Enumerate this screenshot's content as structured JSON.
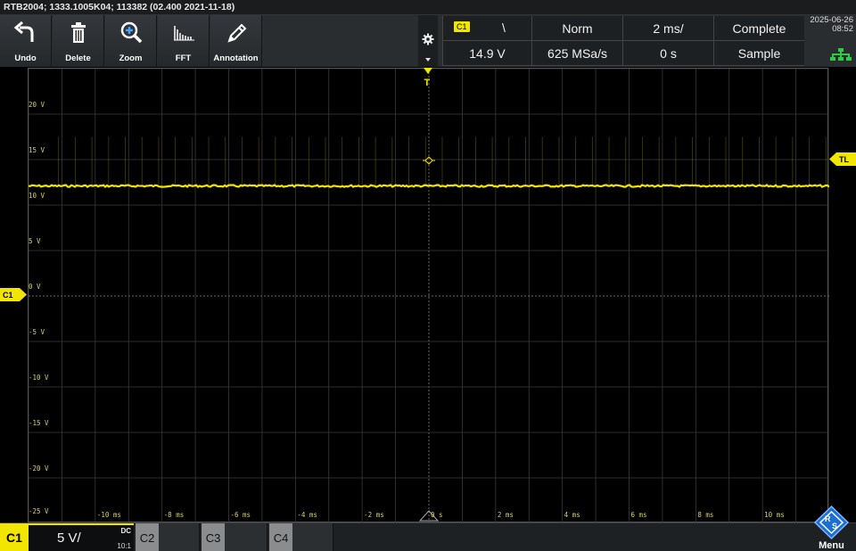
{
  "window": {
    "title": "RTB2004; 1333.1005K04; 113382 (02.400 2021-11-18)"
  },
  "toolbar": {
    "undo_label": "Undo",
    "delete_label": "Delete",
    "zoom_label": "Zoom",
    "fft_label": "FFT",
    "annotation_label": "Annotation"
  },
  "trigger": {
    "source": "C1",
    "slope_symbol": "\\",
    "mode": "Norm",
    "level": "14.9 V"
  },
  "acquisition": {
    "sample_rate": "625 MSa/s",
    "timebase": "2 ms/",
    "position": "0 s",
    "status": "Complete",
    "mode": "Sample"
  },
  "clock": {
    "date": "2025-06-26",
    "time": "08:52"
  },
  "graticule": {
    "y_labels": [
      "20 V",
      "15 V",
      "10 V",
      "5 V",
      "0 V",
      "-5 V",
      "-10 V",
      "-15 V",
      "-20 V",
      "-25 V"
    ],
    "x_labels": [
      "-10 ms",
      "-8 ms",
      "-6 ms",
      "-4 ms",
      "-2 ms",
      "0 s",
      "2 ms",
      "4 ms",
      "6 ms",
      "8 ms",
      "10 ms"
    ]
  },
  "markers": {
    "channel_ref": "C1",
    "trigger_level": "TL",
    "trigger_pos": "T"
  },
  "chart_data": {
    "type": "line",
    "series": [
      {
        "name": "C1",
        "x_range_ms": [
          -12,
          12
        ],
        "y": 12.1,
        "noise_v": 0.1
      }
    ],
    "xlim": [
      -12,
      12
    ],
    "ylim": [
      -25,
      25
    ],
    "grid": true,
    "trace_color": "#f2e500"
  },
  "bottom": {
    "ch1": {
      "label": "C1",
      "scale": "5 V/",
      "coupling": "DC",
      "probe": "10:1"
    },
    "ch2": {
      "label": "C2"
    },
    "ch3": {
      "label": "C3"
    },
    "ch4": {
      "label": "C4"
    },
    "menu_label": "Menu"
  },
  "colors": {
    "ch1": "#f2e500",
    "network_icon": "#2ecc40",
    "grid": "#3a3a3a"
  }
}
